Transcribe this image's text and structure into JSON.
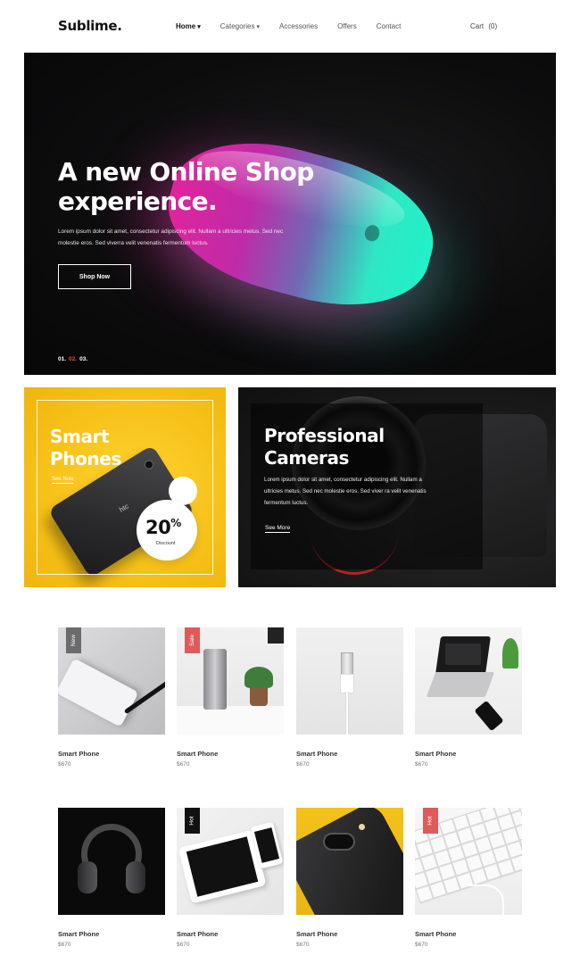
{
  "header": {
    "logo": "Sublime.",
    "nav": [
      {
        "label": "Home",
        "has_dropdown": true,
        "active": true
      },
      {
        "label": "Categories",
        "has_dropdown": true,
        "active": false
      },
      {
        "label": "Accessories",
        "has_dropdown": false,
        "active": false
      },
      {
        "label": "Offers",
        "has_dropdown": false,
        "active": false
      },
      {
        "label": "Contact",
        "has_dropdown": false,
        "active": false
      }
    ],
    "cart_label": "Cart",
    "cart_count": "(0)"
  },
  "hero": {
    "title_line1": "A new Online Shop",
    "title_line2": "experience.",
    "text": "Lorem ipsum dolor sit amet, consectetur adipiscing elit. Nullam a ultricies metus. Sed nec molestie eros. Sed viverra velit venenatis fermentum luctus.",
    "button": "Shop Now",
    "slides": [
      "01.",
      "02.",
      "03."
    ],
    "current_slide": "02."
  },
  "promo_phones": {
    "title_line1": "Smart",
    "title_line2": "Phones",
    "link": "See Now",
    "phone_brand": "htc",
    "discount_value": "20",
    "discount_unit": "%",
    "discount_label": "Discount"
  },
  "promo_cameras": {
    "title_line1": "Professional",
    "title_line2": "Cameras",
    "text": "Lorem ipsum dolor sit amet, consectetur adipiscing elit. Nullam a ultricies metus. Sed nec molestie eros. Sed viver ra velit venenatis fermentum luctus.",
    "link": "See More"
  },
  "products": [
    {
      "name": "Smart Phone",
      "price": "$670",
      "badge": "New",
      "badge_color": "#6b6b6b",
      "image": "iphone-pen"
    },
    {
      "name": "Smart Phone",
      "price": "$670",
      "badge": "Sale",
      "badge_color": "#e05a5a",
      "image": "speaker-plant"
    },
    {
      "name": "Smart Phone",
      "price": "$670",
      "badge": "",
      "badge_color": "",
      "image": "usb-cable"
    },
    {
      "name": "Smart Phone",
      "price": "$670",
      "badge": "",
      "badge_color": "",
      "image": "laptop-desk"
    },
    {
      "name": "Smart Phone",
      "price": "$670",
      "badge": "",
      "badge_color": "",
      "image": "headphones"
    },
    {
      "name": "Smart Phone",
      "price": "$670",
      "badge": "Hot",
      "badge_color": "#111111",
      "image": "tablet-phone"
    },
    {
      "name": "Smart Phone",
      "price": "$670",
      "badge": "",
      "badge_color": "",
      "image": "phone-camera"
    },
    {
      "name": "Smart Phone",
      "price": "$670",
      "badge": "Hot",
      "badge_color": "#e05a5a",
      "image": "keyboard"
    }
  ],
  "colors": {
    "accent": "#e84b3c",
    "hero_bg": "#0d0d0e",
    "promo_yellow": "#f6c118",
    "promo_dark": "#1a1a1b"
  }
}
